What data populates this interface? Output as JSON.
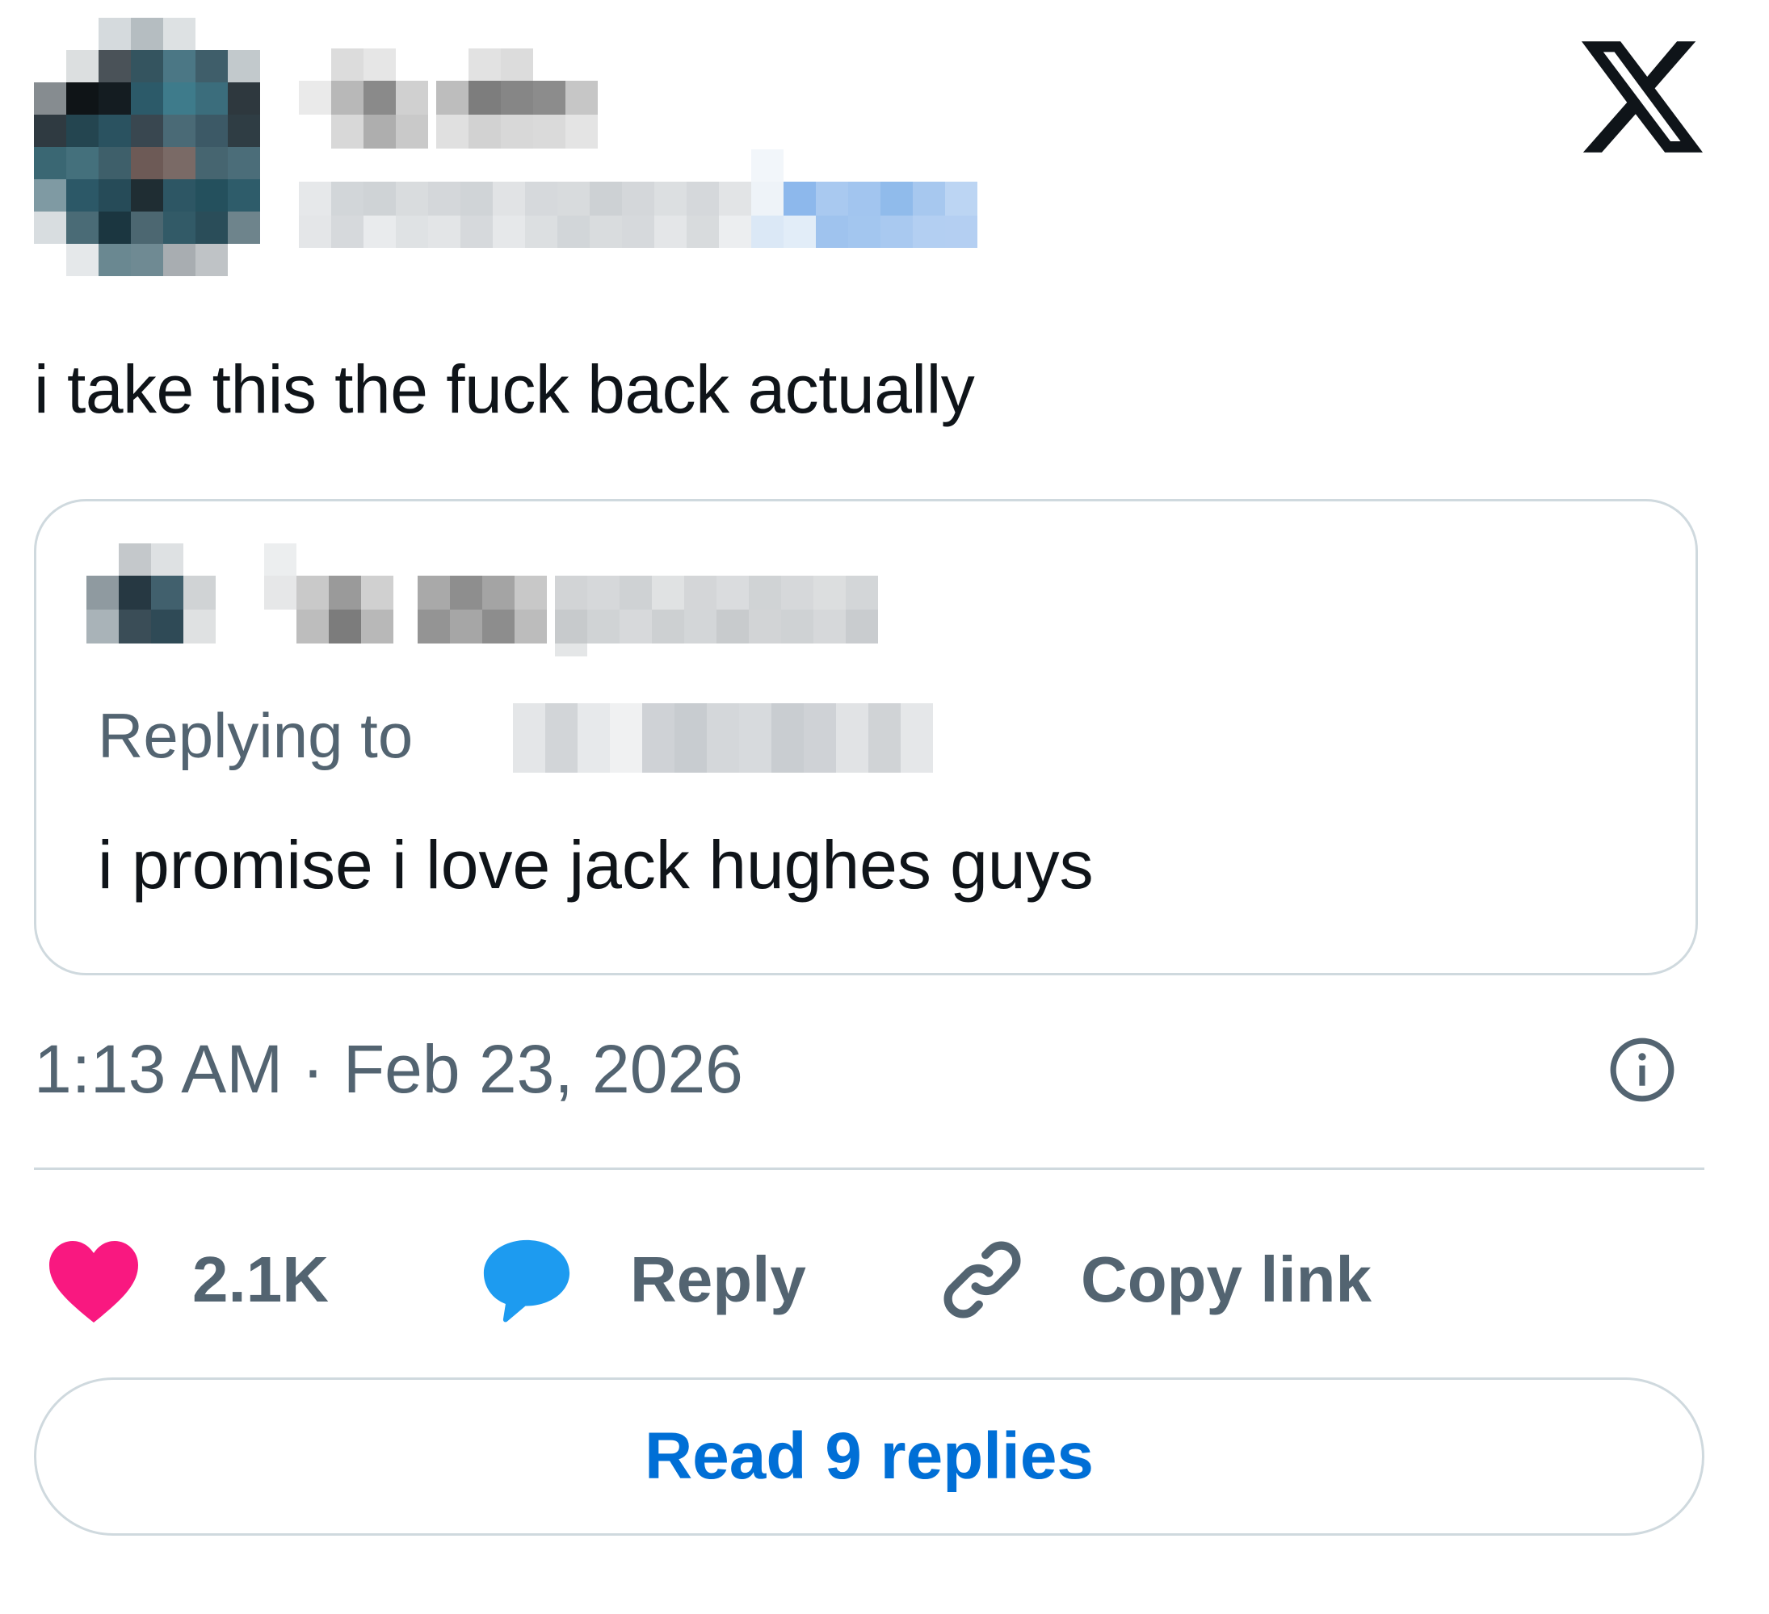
{
  "author": {
    "avatar": "pixelated-avatar",
    "name": "",
    "handle": ""
  },
  "brand": {
    "logo": "x-logo-icon"
  },
  "tweet": {
    "text": "i take this the fuck back actually",
    "timestamp": "1:13 AM · Feb 23, 2026"
  },
  "quoted_tweet": {
    "author_avatar": "pixelated-avatar",
    "author_name": "",
    "replying_to_prefix": "Replying to",
    "replying_to_handle": "",
    "text": "i promise i love jack hughes guys"
  },
  "actions": {
    "like_count": "2.1K",
    "reply_label": "Reply",
    "copy_link_label": "Copy link"
  },
  "footer": {
    "read_replies_label": "Read 9 replies"
  },
  "colors": {
    "like": "#f91880",
    "reply": "#1d9bf0",
    "link_text": "#006fd6",
    "secondary_text": "#536471",
    "border": "#cfd9de"
  }
}
